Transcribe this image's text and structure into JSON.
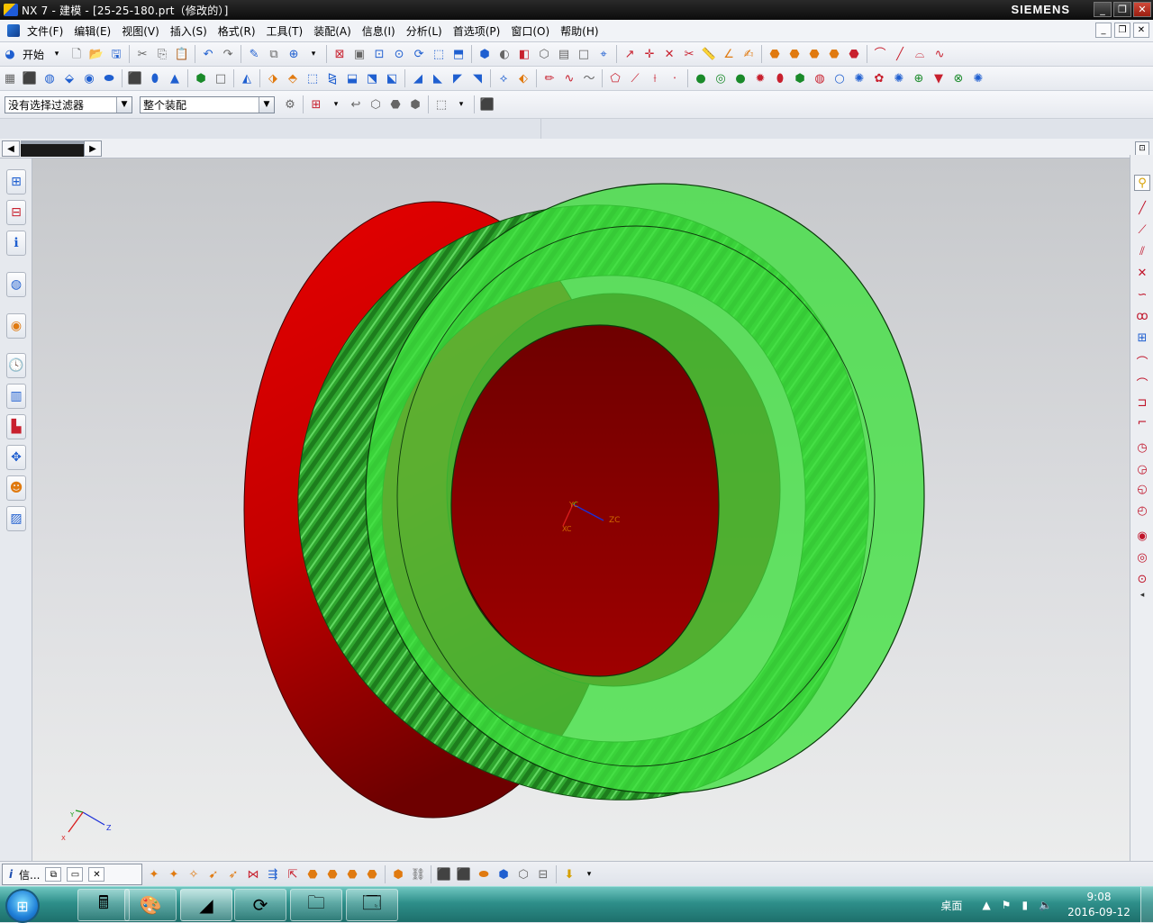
{
  "window": {
    "title": "NX 7 - 建模 - [25-25-180.prt（修改的）]",
    "brand": "SIEMENS",
    "min": "_",
    "restore": "❐",
    "close": "✕"
  },
  "menu": {
    "items": [
      "文件(F)",
      "编辑(E)",
      "视图(V)",
      "插入(S)",
      "格式(R)",
      "工具(T)",
      "装配(A)",
      "信息(I)",
      "分析(L)",
      "首选项(P)",
      "窗口(O)",
      "帮助(H)"
    ],
    "doc_min": "_",
    "doc_restore": "❐",
    "doc_close": "✕"
  },
  "toolbar": {
    "start_label": "开始",
    "filter_value": "没有选择过滤器",
    "scope_value": "整个装配"
  },
  "info_panel": {
    "label": "信..."
  },
  "viewport": {
    "triad_labels": {
      "zc": "ZC",
      "xc": "XC",
      "yc": "YC"
    },
    "mini_triad_labels": {
      "x": "X",
      "y": "Y",
      "z": "Z"
    },
    "colors": {
      "gear_green": "#3ee03e",
      "gear_dark_green": "#1f8e1f",
      "ring_red": "#d50000",
      "ring_dark_red": "#7c0000"
    }
  },
  "taskbar": {
    "desktop_label": "桌面",
    "time": "9:08",
    "date": "2016-09-12"
  }
}
